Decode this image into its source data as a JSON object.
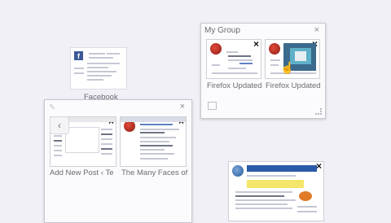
{
  "colors": {
    "background": "#f1f0f6",
    "panel": "#fbfbfd",
    "border": "#c9c8d2"
  },
  "standalone_tab": {
    "label": "Facebook",
    "favicon": "facebook-icon"
  },
  "my_group": {
    "title": "My Group",
    "tabs": [
      {
        "label": "Firefox Updated",
        "favicon": "firefox-icon"
      },
      {
        "label": "Firefox Updated",
        "favicon": "firefox-icon"
      }
    ]
  },
  "left_group": {
    "tabs": [
      {
        "label": "Add New Post ‹ Te"
      },
      {
        "label": "The Many Faces of",
        "favicon": "firefox-icon"
      }
    ],
    "nav_icon": "chevron-left-icon"
  },
  "close_glyph": "×",
  "fb_glyph": "f"
}
